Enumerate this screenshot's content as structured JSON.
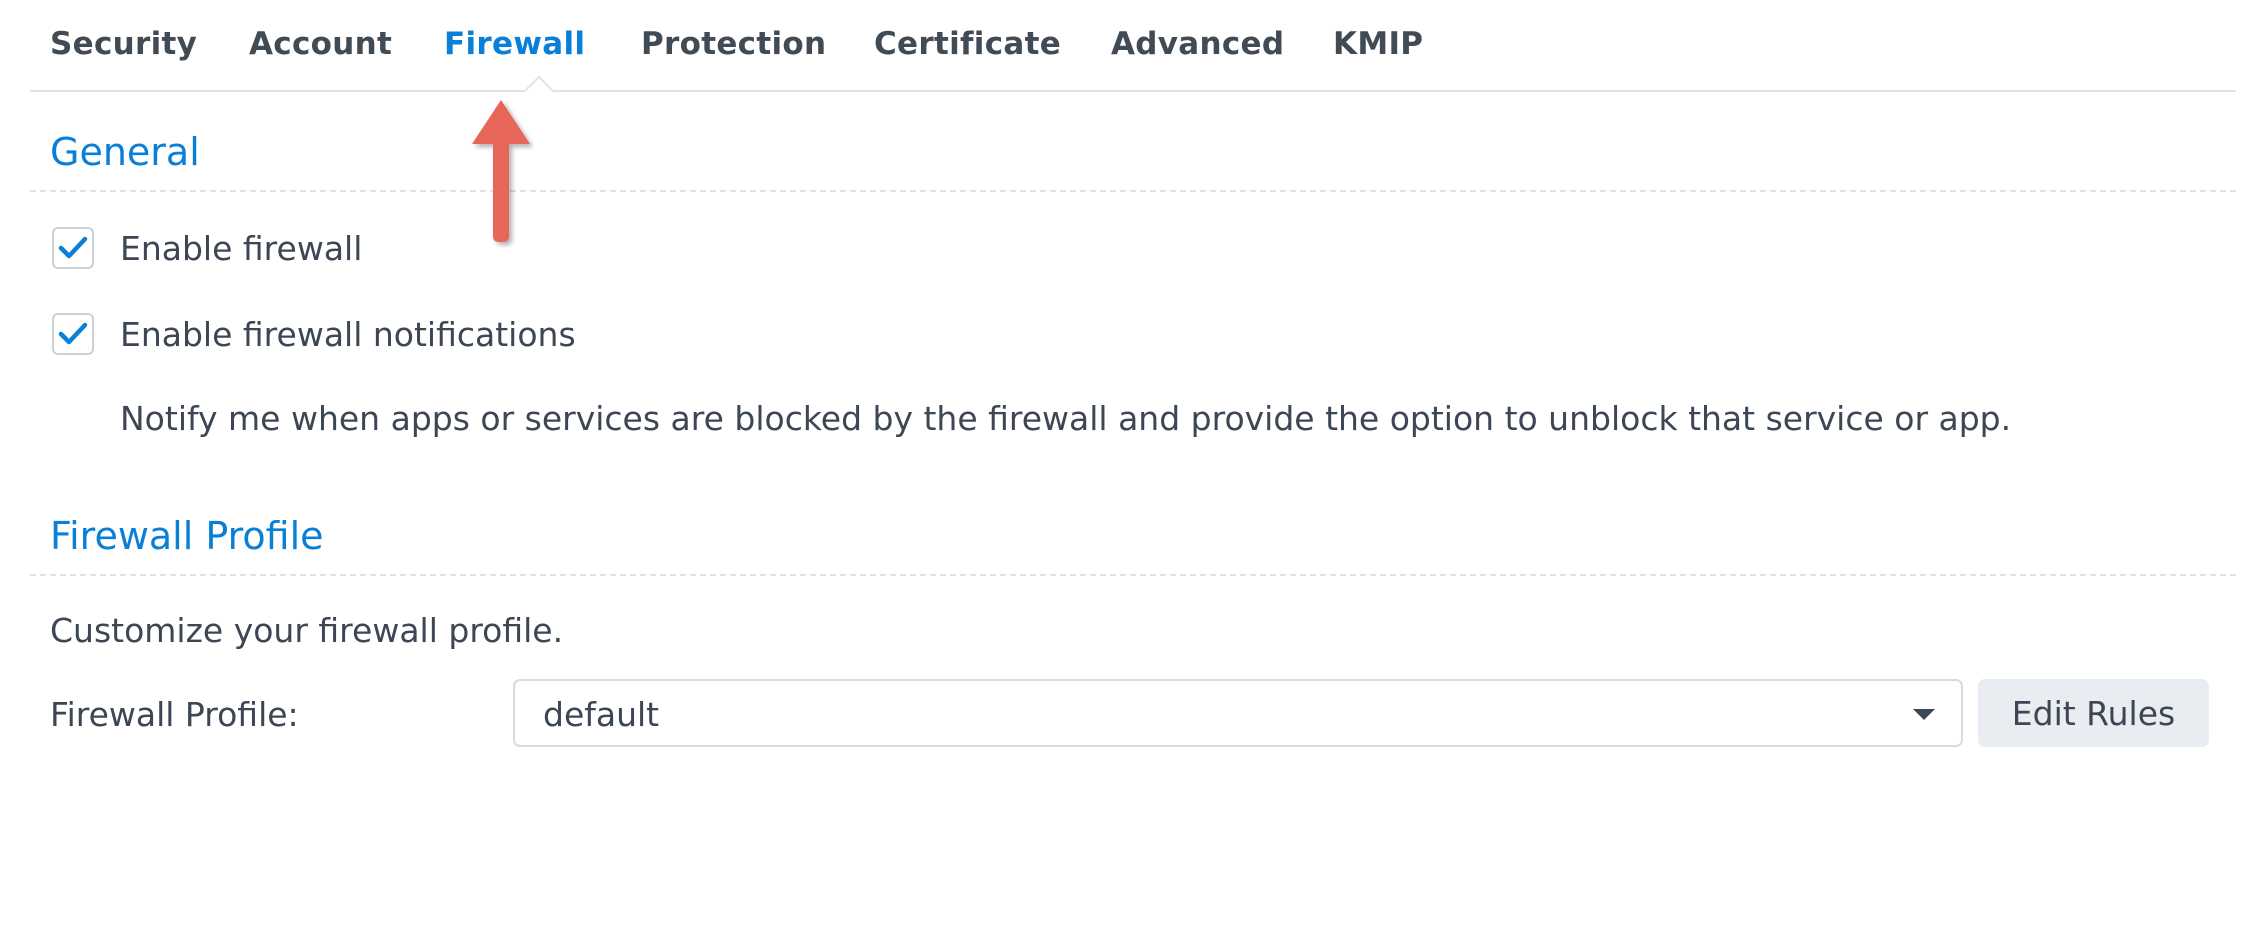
{
  "tabs": [
    {
      "label": "Security",
      "active": false
    },
    {
      "label": "Account",
      "active": false
    },
    {
      "label": "Firewall",
      "active": true
    },
    {
      "label": "Protection",
      "active": false
    },
    {
      "label": "Certificate",
      "active": false
    },
    {
      "label": "Advanced",
      "active": false
    },
    {
      "label": "KMIP",
      "active": false
    }
  ],
  "general": {
    "title": "General",
    "enable_firewall": {
      "label": "Enable firewall",
      "checked": true
    },
    "enable_notifications": {
      "label": "Enable firewall notifications",
      "checked": true
    },
    "notifications_description": "Notify me when apps or services are blocked by the firewall and provide the option to unblock that service or app."
  },
  "firewall_profile": {
    "title": "Firewall Profile",
    "description": "Customize your firewall profile.",
    "field_label": "Firewall Profile:",
    "selected_value": "default",
    "edit_button_label": "Edit Rules"
  },
  "annotation": {
    "arrow_icon": "red-arrow-up-icon",
    "color": "#e8655a"
  },
  "colors": {
    "accent": "#0a7fd8",
    "text": "#3c4654",
    "border": "#dfe3e8",
    "button_bg": "#e9edf1"
  }
}
